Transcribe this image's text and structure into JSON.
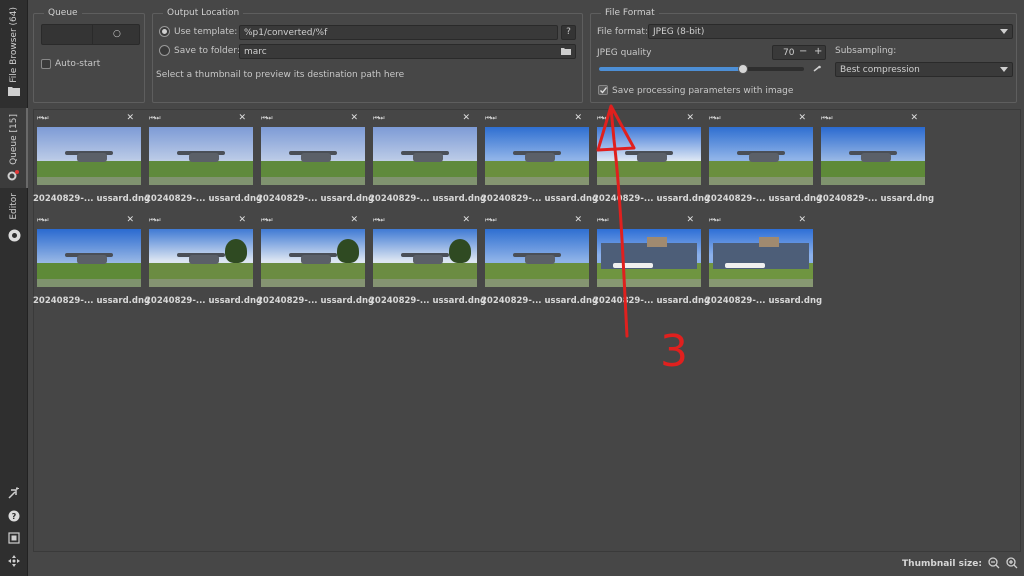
{
  "sidebar": {
    "tabs": [
      {
        "label": "File Browser (64)"
      },
      {
        "label": "Queue [15]"
      },
      {
        "label": "Editor"
      }
    ],
    "bottom_icons": [
      "new-window-icon",
      "help-icon",
      "fullscreen-icon",
      "move-icon"
    ]
  },
  "queue": {
    "title": "Queue",
    "autostart_label": "Auto-start",
    "autostart_checked": false
  },
  "output": {
    "title": "Output Location",
    "use_template_label": "Use template:",
    "template_value": "%p1/converted/%f",
    "template_help": "?",
    "save_folder_label": "Save to folder:",
    "folder_value": "marc",
    "hint": "Select a thumbnail to preview its destination path here"
  },
  "format": {
    "title": "File Format",
    "file_format_label": "File format:",
    "file_format_value": "JPEG (8-bit)",
    "jpeg_quality_label": "JPEG quality",
    "jpeg_quality_value": "70",
    "jpeg_quality_fraction": 0.7,
    "subsampling_label": "Subsampling:",
    "subsampling_value": "Best compression",
    "save_params_label": "Save processing parameters with image",
    "save_params_checked": true
  },
  "thumbnails": [
    {
      "name": "20240829-... ussard.dng",
      "scene": "plane-cloudy"
    },
    {
      "name": "20240829-... ussard.dng",
      "scene": "plane-cloudy"
    },
    {
      "name": "20240829-... ussard.dng",
      "scene": "plane-cloudy"
    },
    {
      "name": "20240829-... ussard.dng",
      "scene": "plane-cloudy"
    },
    {
      "name": "20240829-... ussard.dng",
      "scene": "plane-sky"
    },
    {
      "name": "20240829-... ussard.dng",
      "scene": "plane-far"
    },
    {
      "name": "20240829-... ussard.dng",
      "scene": "plane-sky"
    },
    {
      "name": "20240829-... ussard.dng",
      "scene": "plane-front"
    },
    {
      "name": "20240829-... ussard.dng",
      "scene": "plane-front"
    },
    {
      "name": "20240829-... ussard.dng",
      "scene": "plane-tree"
    },
    {
      "name": "20240829-... ussard.dng",
      "scene": "plane-tree"
    },
    {
      "name": "20240829-... ussard.dng",
      "scene": "plane-tree"
    },
    {
      "name": "20240829-... ussard.dng",
      "scene": "plane-sky"
    },
    {
      "name": "20240829-... ussard.dng",
      "scene": "hangar"
    },
    {
      "name": "20240829-... ussard.dng",
      "scene": "hangar"
    }
  ],
  "status": {
    "thumb_size_label": "Thumbnail size:"
  },
  "annotation": {
    "number": "3",
    "color": "#e0201e"
  }
}
